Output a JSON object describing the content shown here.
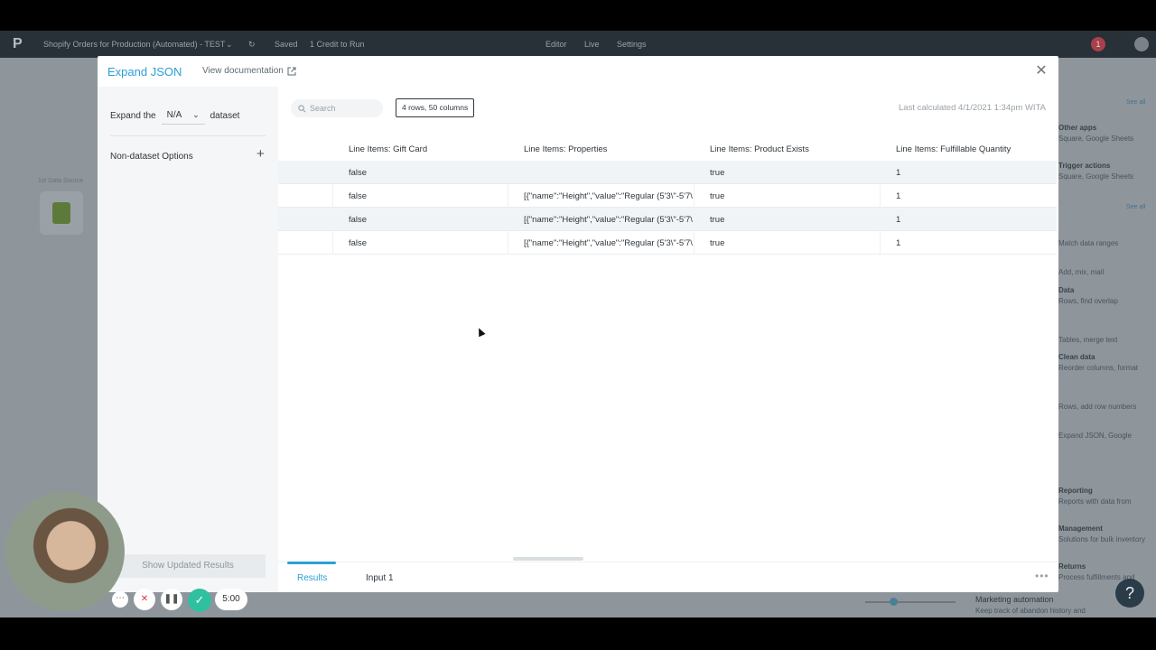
{
  "appbar": {
    "title": "Shopify Orders for Production (Automated) - TEST",
    "saved": "Saved",
    "credit": "1 Credit to Run",
    "tabs": [
      "Editor",
      "Live",
      "Settings"
    ],
    "badge": "1"
  },
  "background_panel": {
    "items": [
      "See all",
      "Other apps",
      "Square, Google Sheets",
      "Trigger actions",
      "Square, Google Sheets",
      "See all",
      "Match data ranges",
      "Add, mix, mail",
      "Data",
      "Rows, find overlap",
      "Tables, merge text",
      "Clean data",
      "Reorder columns, format",
      "Rows, add row numbers",
      "Expand JSON, Google",
      "Reporting",
      "Reports with data from",
      "Management",
      "Solutions for bulk inventory",
      "Returns",
      "Process fulfillments and"
    ],
    "marketing_title": "Marketing automation",
    "marketing_sub": "Keep track of abandon history and",
    "left_node_label": "1st Data Source"
  },
  "modal": {
    "title": "Expand JSON",
    "doc_link": "View documentation",
    "expand_prefix": "Expand the",
    "expand_select": "N/A",
    "expand_suffix": "dataset",
    "non_dataset": "Non-dataset Options",
    "show_updated": "Show Updated Results",
    "search_placeholder": "Search",
    "rows_cols": "4 rows, 50 columns",
    "last_calculated": "Last calculated 4/1/2021 1:34pm WITA",
    "columns": [
      "Line Items: Gift Card",
      "Line Items: Properties",
      "Line Items: Product Exists",
      "Line Items: Fulfillable Quantity"
    ],
    "rows": [
      [
        "false",
        "",
        "true",
        "1"
      ],
      [
        "false",
        "[{\"name\":\"Height\",\"value\":\"Regular (5'3\\\"-5'7\\",
        "true",
        "1"
      ],
      [
        "false",
        "[{\"name\":\"Height\",\"value\":\"Regular (5'3\\\"-5'7\\",
        "true",
        "1"
      ],
      [
        "false",
        "[{\"name\":\"Height\",\"value\":\"Regular (5'3\\\"-5'7\\",
        "true",
        "1"
      ]
    ],
    "tabs": [
      "Results",
      "Input 1"
    ],
    "more": "•••"
  },
  "recorder": {
    "timer": "5:00"
  },
  "help": "?"
}
